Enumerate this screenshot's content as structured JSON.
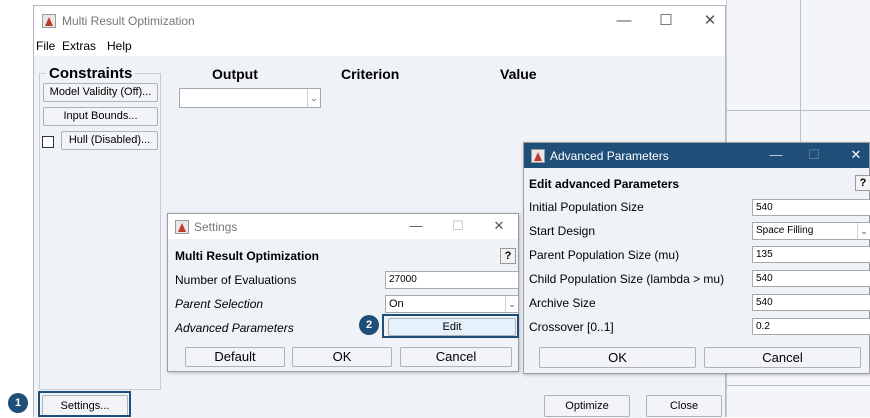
{
  "main_window": {
    "title": "Multi Result Optimization",
    "minimize": "—",
    "maximize": "☐",
    "close": "✕",
    "menu": [
      "File",
      "Extras",
      "Help"
    ],
    "constraints_label": "Constraints",
    "constraint_buttons": [
      "Model Validity (Off)...",
      "Input Bounds...",
      "Hull (Disabled)..."
    ],
    "columns": {
      "output": "Output",
      "criterion": "Criterion",
      "value": "Value"
    },
    "output_select_value": "",
    "settings_button": "Settings...",
    "optimize_button": "Optimize",
    "close_button": "Close"
  },
  "settings_dialog": {
    "title": "Settings",
    "minimize": "—",
    "maximize": "☐",
    "close": "✕",
    "header": "Multi Result Optimization",
    "help": "?",
    "rows": [
      {
        "label": "Number of Evaluations",
        "value": "27000"
      },
      {
        "label": "Parent Selection",
        "value": "On"
      },
      {
        "label": "Advanced Parameters",
        "value": "Edit"
      }
    ],
    "buttons": {
      "default": "Default",
      "ok": "OK",
      "cancel": "Cancel"
    }
  },
  "advanced_dialog": {
    "title": "Advanced Parameters",
    "minimize": "—",
    "maximize": "☐",
    "close": "✕",
    "header": "Edit advanced Parameters",
    "help": "?",
    "rows": [
      {
        "label": "Initial Population Size",
        "value": "540"
      },
      {
        "label": "Start Design",
        "value": "Space Filling"
      },
      {
        "label": "Parent Population Size (mu)",
        "value": "135"
      },
      {
        "label": "Child Population Size (lambda > mu)",
        "value": "540"
      },
      {
        "label": "Archive Size",
        "value": "540"
      },
      {
        "label": "Crossover [0..1]",
        "value": "0.2"
      }
    ],
    "buttons": {
      "ok": "OK",
      "cancel": "Cancel"
    }
  },
  "markers": {
    "step1": "1",
    "step2": "2"
  },
  "icons": {
    "window": "matlab-icon",
    "dropdown": "chevron-down-icon"
  },
  "colors": {
    "marker": "#1f4e79",
    "title_bar_active": "#1f4e79",
    "panel_bg": "#eff3f8"
  }
}
